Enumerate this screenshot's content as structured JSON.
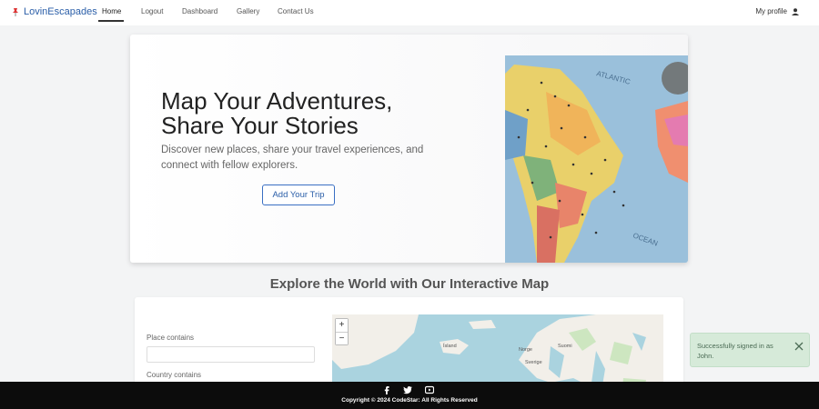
{
  "nav": {
    "brand": "LovinEscapades",
    "links": [
      "Home",
      "Logout",
      "Dashboard",
      "Gallery",
      "Contact Us"
    ],
    "active": "Home",
    "profile": "My profile"
  },
  "hero": {
    "title_line1": "Map Your Adventures,",
    "title_line2": "Share Your Stories",
    "subtitle": "Discover new places, share your travel experiences, and connect with fellow explorers.",
    "button": "Add Your Trip",
    "image_text": [
      "ATLANTIC",
      "OCEAN"
    ]
  },
  "map_section": {
    "title": "Explore the World with Our Interactive Map",
    "place_label": "Place contains",
    "country_label": "Country contains",
    "zoom_in": "+",
    "zoom_out": "−",
    "labels": [
      "Ísland",
      "Norge",
      "Suomi",
      "Sverige"
    ]
  },
  "toast": {
    "message": "Successfully signed in as John."
  },
  "footer": {
    "copyright": "Copyright © 2024 CodeStar: All Rights Reserved",
    "social_icons": [
      "facebook-icon",
      "twitter-icon",
      "youtube-icon"
    ]
  },
  "colors": {
    "brand": "#2a5ea8",
    "toast_bg": "#d6ead9",
    "footer_bg": "#0c0c0c",
    "map_sea": "#aad3df"
  }
}
